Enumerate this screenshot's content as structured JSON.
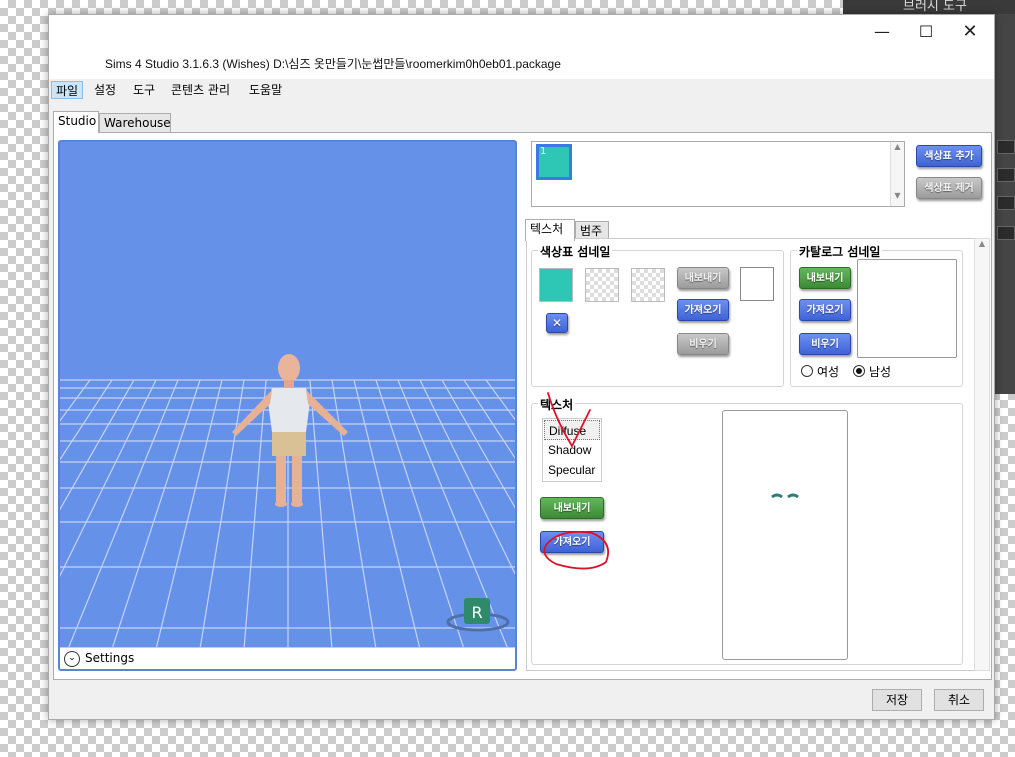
{
  "background_app": {
    "toolbar_label": "브러시 도구"
  },
  "window": {
    "title": "Sims 4 Studio 3.1.6.3 (Wishes)  D:\\심즈 옷만들기\\눈썹만들\\roomerkim0h0eb01.package",
    "minimize_glyph": "—",
    "maximize_glyph": "☐",
    "close_glyph": "✕"
  },
  "menu": {
    "items": [
      "파일",
      "설정",
      "도구",
      "콘텐츠 관리",
      "도움말"
    ]
  },
  "main_tabs": [
    "Studio",
    "Warehouse"
  ],
  "viewport": {
    "settings_label": "Settings",
    "reset_badge": "R"
  },
  "swatches": {
    "item_label": "1",
    "add_button": "색상표 추가",
    "remove_button": "색상표 제거",
    "swatch_color": "#2ec7b6"
  },
  "sub_tabs": [
    "텍스처",
    "범주"
  ],
  "swatch_thumbnail": {
    "title": "색상표 섬네일",
    "export_button": "내보내기",
    "import_button": "가져오기",
    "clear_button": "비우기",
    "remove_glyph": "✕"
  },
  "catalog_thumbnail": {
    "title": "카탈로그 섬네일",
    "export_button": "내보내기",
    "import_button": "가져오기",
    "clear_button": "비우기",
    "female_label": "여성",
    "male_label": "남성",
    "selected_gender": "남성"
  },
  "texture": {
    "title": "텍스처",
    "items": [
      "Diffuse",
      "Shadow",
      "Specular"
    ],
    "selected": "Diffuse",
    "export_button": "내보내기",
    "import_button": "가져오기"
  },
  "footer": {
    "save_button": "저장",
    "cancel_button": "취소"
  },
  "colors": {
    "viewport_bg": "#6592e8",
    "accent_blue": "#3e63d6",
    "accent_green": "#3b8b35",
    "annotation_red": "#e0102a"
  }
}
